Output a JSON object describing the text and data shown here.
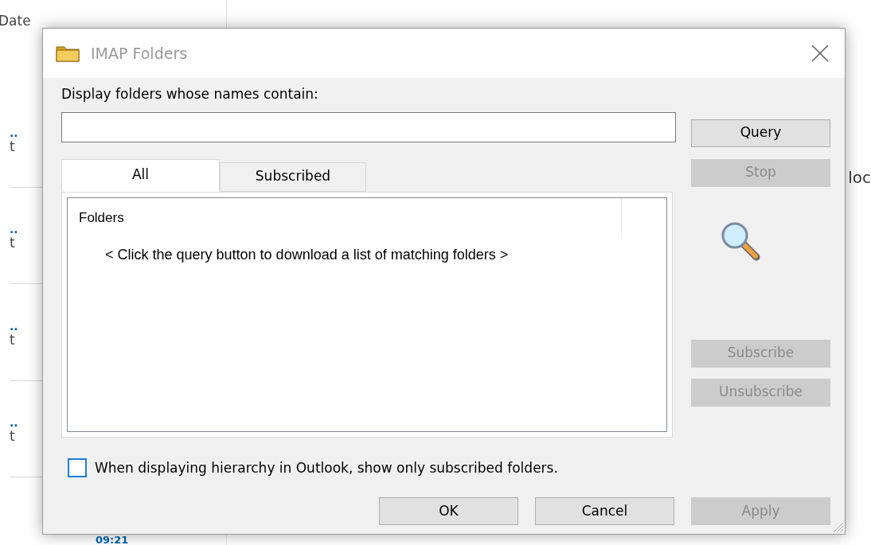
{
  "background": {
    "list_header": "Date",
    "rows": [
      {
        "dots": "..",
        "text": "t"
      },
      {
        "dots": "..",
        "text": "t"
      },
      {
        "dots": "..",
        "text": "t"
      },
      {
        "dots": "..",
        "text": "t"
      }
    ],
    "last_time": "09:21",
    "reading_pane_text": "loc"
  },
  "dialog": {
    "title": "IMAP Folders",
    "filter_label": "Display folders whose names contain:",
    "side_buttons": [
      {
        "label": "Query",
        "disabled": false
      },
      {
        "label": "Stop",
        "disabled": true
      }
    ],
    "tabs": [
      {
        "label": "All",
        "selected": true
      },
      {
        "label": "Subscribed",
        "selected": false
      }
    ],
    "folder_list": {
      "column": "Folders",
      "message": "< Click the query button to download a list of matching folders >"
    },
    "subscribe_buttons": [
      {
        "label": "Subscribe",
        "disabled": true
      },
      {
        "label": "Unsubscribe",
        "disabled": true
      }
    ],
    "checkbox": {
      "label": "When displaying hierarchy in Outlook, show only subscribed folders.",
      "checked": false
    },
    "footer_buttons": [
      {
        "label": "OK",
        "disabled": false
      },
      {
        "label": "Cancel",
        "disabled": false
      },
      {
        "label": "Apply",
        "disabled": true
      }
    ]
  }
}
